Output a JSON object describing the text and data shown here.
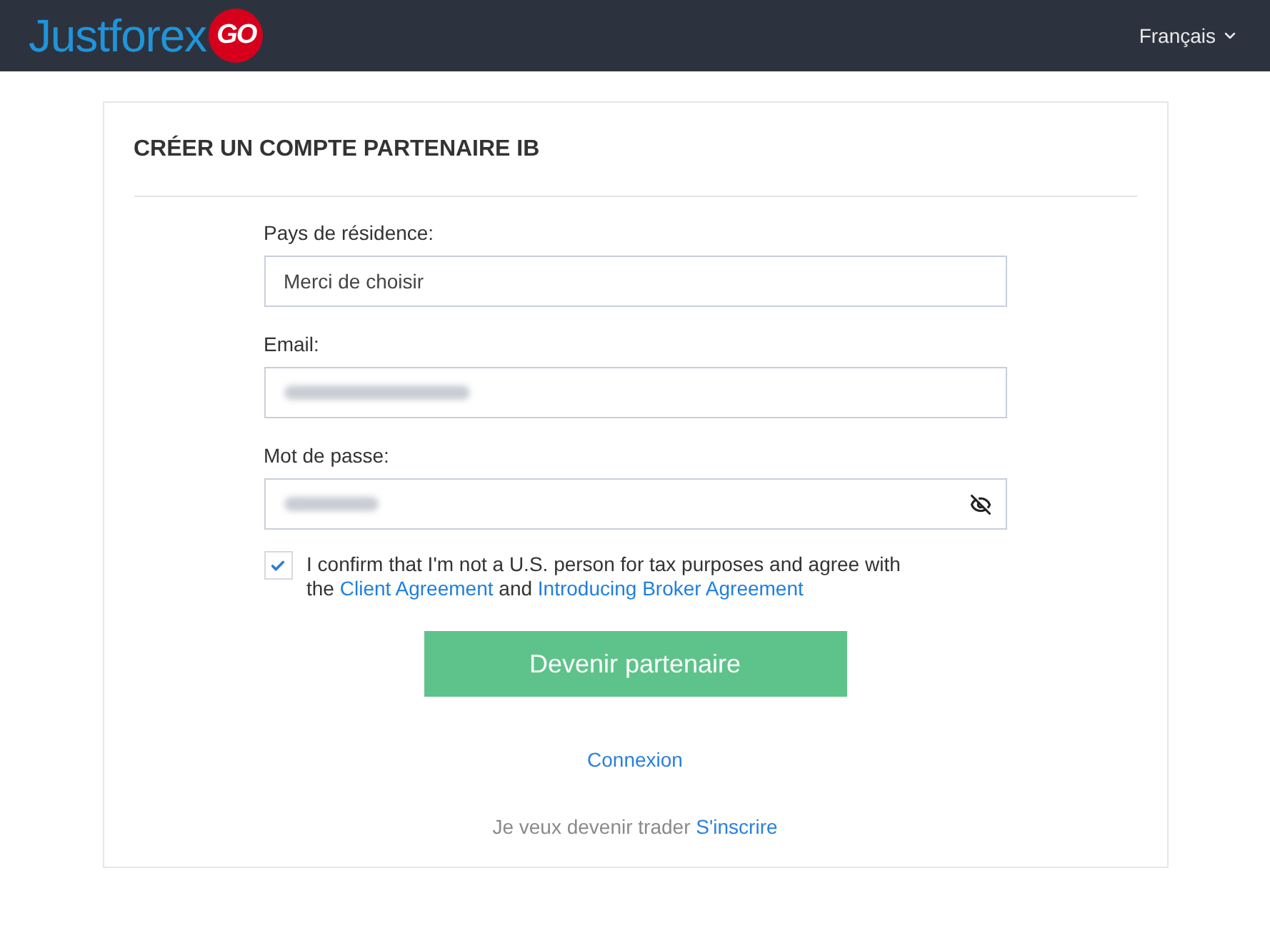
{
  "header": {
    "logo": {
      "text": "Justforex",
      "badge": "GO"
    },
    "language": {
      "label": "Français",
      "expanded": false
    }
  },
  "card": {
    "title": "CRÉER UN COMPTE PARTENAIRE IB",
    "fields": [
      {
        "kind": "select",
        "label": "Pays de résidence:",
        "value": "Merci de choisir"
      },
      {
        "kind": "email",
        "label": "Email:",
        "redacted": true
      },
      {
        "kind": "password",
        "label": "Mot de passe:",
        "redacted": true,
        "password_visible": false
      }
    ],
    "consent": {
      "checked": true,
      "parts": [
        {
          "kind": "text",
          "text": "I confirm that I'm not a U.S. person for tax purposes and agree with the "
        },
        {
          "kind": "link",
          "text": "Client Agreement"
        },
        {
          "kind": "text",
          "text": " and "
        },
        {
          "kind": "link",
          "text": "Introducing Broker Agreement"
        }
      ]
    },
    "submit": {
      "label": "Devenir partenaire"
    },
    "login_link": {
      "label": "Connexion"
    },
    "signup": {
      "text": "Je veux devenir trader",
      "link": "S'inscrire"
    }
  }
}
